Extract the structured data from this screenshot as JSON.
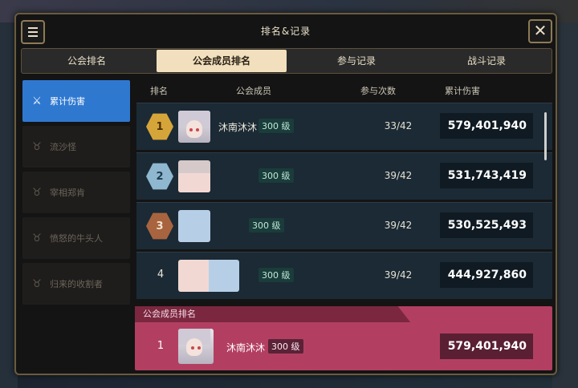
{
  "window": {
    "title": "排名&记录"
  },
  "tabs": [
    {
      "label": "公会排名"
    },
    {
      "label": "公会成员排名"
    },
    {
      "label": "参与记录"
    },
    {
      "label": "战斗记录"
    }
  ],
  "sidebar": {
    "items": [
      {
        "label": "累计伤害",
        "icon": "sword-icon"
      },
      {
        "label": "流沙怪",
        "icon": "bull-icon"
      },
      {
        "label": "宰相郑肯",
        "icon": "bull-icon"
      },
      {
        "label": "愤怒的牛头人",
        "icon": "bull-icon"
      },
      {
        "label": "归来的收割者",
        "icon": "bull-icon"
      }
    ]
  },
  "table": {
    "headers": {
      "rank": "排名",
      "member": "公会成员",
      "count": "参与次数",
      "damage": "累计伤害"
    },
    "rows": [
      {
        "rank": "1",
        "name": "沐南沐沐",
        "level": "300 级",
        "count": "33/42",
        "damage": "579,401,940"
      },
      {
        "rank": "2",
        "name": "",
        "level": "300 级",
        "count": "39/42",
        "damage": "531,743,419"
      },
      {
        "rank": "3",
        "name": "",
        "level": "300 级",
        "count": "39/42",
        "damage": "530,525,493"
      },
      {
        "rank": "4",
        "name": "",
        "level": "300 级",
        "count": "39/42",
        "damage": "444,927,860"
      }
    ]
  },
  "my_rank": {
    "header": "公会成员排名",
    "rank": "1",
    "name": "沐南沐沐",
    "level": "300 级",
    "damage": "579,401,940"
  },
  "colors": {
    "gold": "#d6a53a",
    "silver": "#8fb7cf",
    "bronze": "#a8643f",
    "accent_blue": "#2f78d0",
    "my_rank_bg": "#b23f62"
  }
}
